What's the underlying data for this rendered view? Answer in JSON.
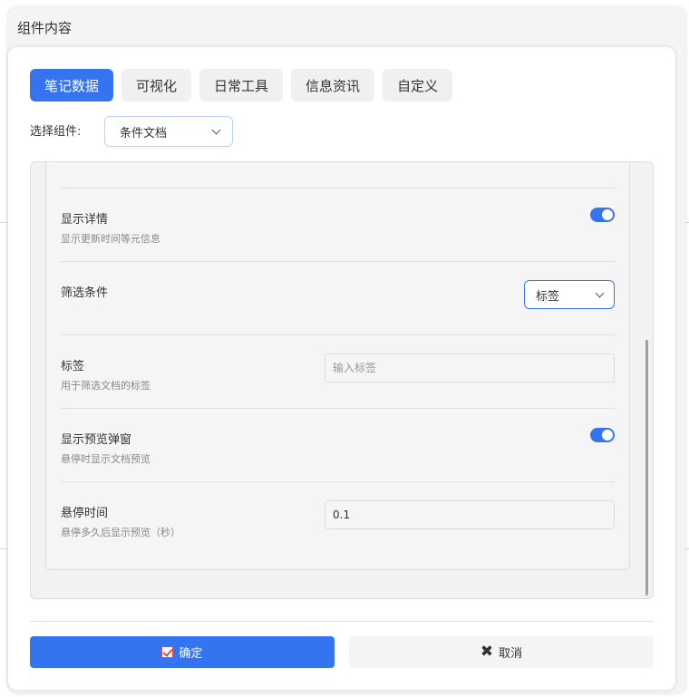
{
  "outer_title": "组件内容",
  "tabs": [
    {
      "label": "笔记数据",
      "active": true
    },
    {
      "label": "可视化",
      "active": false
    },
    {
      "label": "日常工具",
      "active": false
    },
    {
      "label": "信息资讯",
      "active": false
    },
    {
      "label": "自定义",
      "active": false
    }
  ],
  "component_picker": {
    "label": "选择组件:",
    "value": "条件文档"
  },
  "settings": {
    "show_details": {
      "title": "显示详情",
      "desc": "显示更新时间等元信息",
      "enabled": true
    },
    "filter": {
      "title": "筛选条件",
      "value": "标签"
    },
    "tag": {
      "title": "标签",
      "desc": "用于筛选文档的标签",
      "placeholder": "输入标签",
      "value": ""
    },
    "preview_popup": {
      "title": "显示预览弹窗",
      "desc": "悬停时显示文档预览",
      "enabled": true
    },
    "hover_time": {
      "title": "悬停时间",
      "desc": "悬停多久后显示预览（秒）",
      "value": "0.1"
    }
  },
  "footer": {
    "ok_label": "确定",
    "cancel_label": "取消"
  },
  "colors": {
    "accent": "#3574f0",
    "check_red": "#e04b4b"
  },
  "icons": {
    "ok": "checkbox-check-icon",
    "cancel": "close-icon",
    "dropdown": "chevron-down-icon"
  }
}
